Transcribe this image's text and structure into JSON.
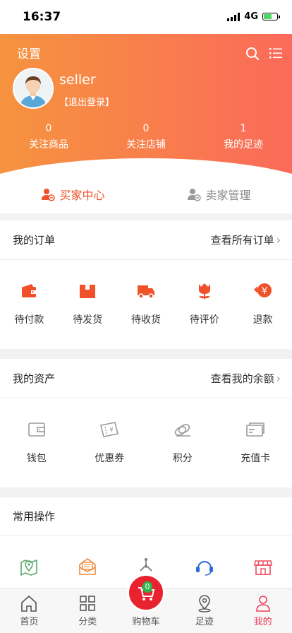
{
  "status_bar": {
    "time": "16:37",
    "network": "4G"
  },
  "header": {
    "settings_label": "设置",
    "username": "seller",
    "logout_label": "【退出登录】",
    "stats": [
      {
        "value": "0",
        "label": "关注商品"
      },
      {
        "value": "0",
        "label": "关注店铺"
      },
      {
        "value": "1",
        "label": "我的足迹"
      }
    ]
  },
  "role_tabs": {
    "buyer": "买家中心",
    "seller": "卖家管理"
  },
  "orders": {
    "title": "我的订单",
    "more": "查看所有订单",
    "items": [
      {
        "label": "待付款",
        "icon": "wallet-icon"
      },
      {
        "label": "待发货",
        "icon": "package-icon"
      },
      {
        "label": "待收货",
        "icon": "truck-icon"
      },
      {
        "label": "待评价",
        "icon": "flower-icon"
      },
      {
        "label": "退款",
        "icon": "refund-icon"
      }
    ]
  },
  "assets": {
    "title": "我的资产",
    "more": "查看我的余额",
    "items": [
      {
        "label": "钱包",
        "icon": "wallet-outline-icon"
      },
      {
        "label": "优惠券",
        "icon": "coupon-icon"
      },
      {
        "label": "积分",
        "icon": "coins-icon"
      },
      {
        "label": "充值卡",
        "icon": "card-icon"
      }
    ]
  },
  "common": {
    "title": "常用操作",
    "items": [
      {
        "icon": "map-pin-icon"
      },
      {
        "icon": "mail-icon"
      },
      {
        "icon": "share-icon"
      },
      {
        "icon": "headset-icon"
      },
      {
        "icon": "store-icon"
      }
    ]
  },
  "tabbar": {
    "items": [
      {
        "label": "首页",
        "icon": "home-icon"
      },
      {
        "label": "分类",
        "icon": "grid-icon"
      },
      {
        "label": "购物车",
        "icon": "cart-icon"
      },
      {
        "label": "足迹",
        "icon": "location-icon"
      },
      {
        "label": "我的",
        "icon": "user-icon"
      }
    ],
    "cart_count": "0"
  },
  "colors": {
    "accent": "#f0502a",
    "active_tab": "#ef3a5a"
  }
}
